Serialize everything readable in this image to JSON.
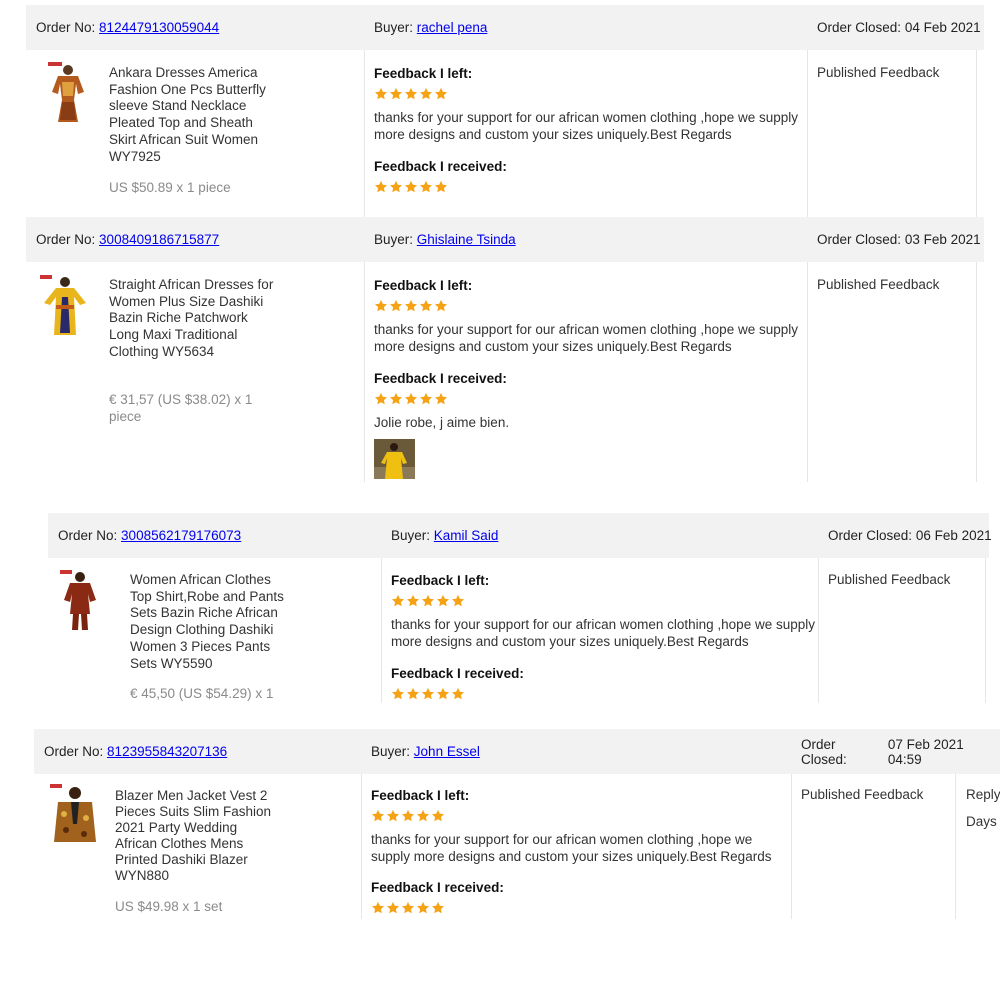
{
  "labels": {
    "order_no": "Order No:",
    "buyer": "Buyer:",
    "order_closed": "Order Closed:",
    "feedback_left": "Feedback I left:",
    "feedback_received": "Feedback I received:",
    "published": "Published Feedback"
  },
  "colors": {
    "star": "#f5a315",
    "link": "#2d6fb7",
    "header_bg": "#f2f2f2"
  },
  "orders": [
    {
      "order_no": "8124479130059044",
      "buyer": "rachel pena",
      "closed": "04 Feb 2021",
      "product_name": "Ankara Dresses America Fashion One Pcs Butterfly sleeve Stand Necklace Pleated Top and Sheath Skirt African Suit Women WY7925",
      "price": "US $50.89 x 1 piece",
      "left_rating": 5,
      "left_text": "thanks for your support for our african women clothing ,hope we supply more designs and custom your sizes uniquely.Best Regards",
      "received_rating": 5,
      "status": "Published Feedback"
    },
    {
      "order_no": "3008409186715877",
      "buyer": "Ghislaine Tsinda",
      "closed": "03 Feb 2021",
      "product_name": "Straight African Dresses for Women Plus Size Dashiki Bazin Riche Patchwork Long Maxi Traditional Clothing WY5634",
      "price": "€ 31,57 (US $38.02) x 1 piece",
      "left_rating": 5,
      "left_text": "thanks for your support for our african women clothing ,hope we supply more designs and custom your sizes uniquely.Best Regards",
      "received_rating": 5,
      "received_text": "Jolie robe, j aime bien.",
      "status": "Published Feedback"
    },
    {
      "order_no": "3008562179176073",
      "buyer": "Kamil Said",
      "closed": "06 Feb 2021",
      "product_name": "Women African Clothes Top Shirt,Robe and Pants Sets Bazin Riche African Design Clothing Dashiki Women 3 Pieces Pants Sets WY5590",
      "price": "€ 45,50 (US $54.29) x 1",
      "left_rating": 5,
      "left_text": "thanks for your support for our african women clothing ,hope we supply more designs and custom your sizes uniquely.Best Regards",
      "received_rating": 5,
      "status": "Published Feedback"
    },
    {
      "order_no": "8123955843207136",
      "buyer": "John Essel",
      "closed": "07 Feb 2021 04:59",
      "product_name": "Blazer Men Jacket Vest 2 Pieces Suits Slim Fashion 2021 Party Wedding African Clothes Mens Printed Dashiki Blazer WYN880",
      "price": "US $49.98 x 1 set",
      "left_rating": 5,
      "left_text": "thanks for your support for our african women clothing ,hope we supply more designs and custom your sizes uniquely.Best Regards",
      "received_rating": 5,
      "status": "Published Feedback",
      "reply_link": "Reply",
      "days_text": "Days"
    }
  ]
}
